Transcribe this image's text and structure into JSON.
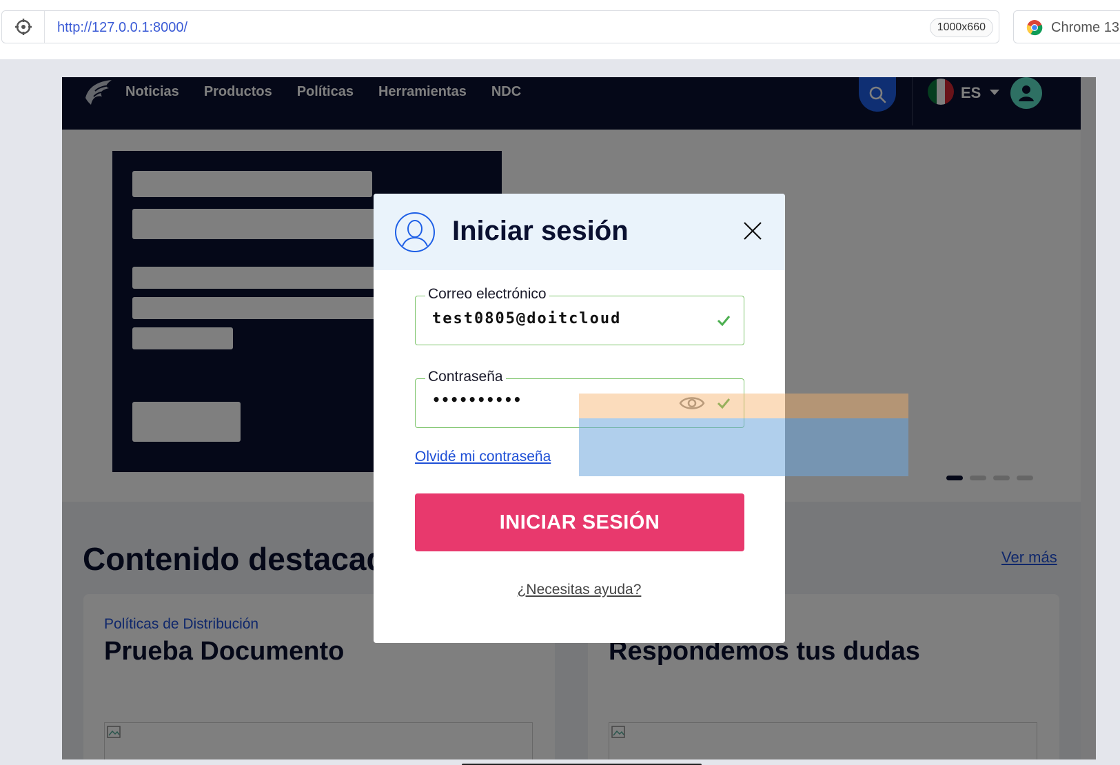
{
  "browser": {
    "url": "http://127.0.0.1:8000/",
    "viewport_size": "1000x660",
    "browser_name": "Chrome 13"
  },
  "nav": {
    "links": [
      "Noticias",
      "Productos",
      "Políticas",
      "Herramientas",
      "NDC"
    ],
    "language": "ES"
  },
  "featured": {
    "title": "Contenido destacado",
    "see_more": "Ver más",
    "cards": [
      {
        "category": "Políticas de Distribución",
        "title": "Prueba Documento"
      },
      {
        "category": "",
        "title": "Respondemos tus dudas"
      }
    ]
  },
  "modal": {
    "title": "Iniciar sesión",
    "email_label": "Correo electrónico",
    "email_value": "test0805@doitcloud",
    "password_label": "Contraseña",
    "password_value": "••••••••••",
    "forgot_link": "Olvidé mi contraseña",
    "submit_label": "INICIAR SESIÓN",
    "help_link": "¿Necesitas ayuda?"
  },
  "colors": {
    "navy": "#0a1030",
    "accent_blue": "#1e5fe6",
    "submit_pink": "#e8396d",
    "valid_green": "#7cc46a",
    "avatar_teal": "#5de0c6"
  },
  "icons": [
    "target-icon",
    "chrome-icon",
    "logo-icon",
    "search-icon",
    "mexico-flag-icon",
    "caret-down-icon",
    "user-icon",
    "user-circle-icon",
    "close-icon",
    "check-icon",
    "eye-icon",
    "broken-image-icon"
  ]
}
